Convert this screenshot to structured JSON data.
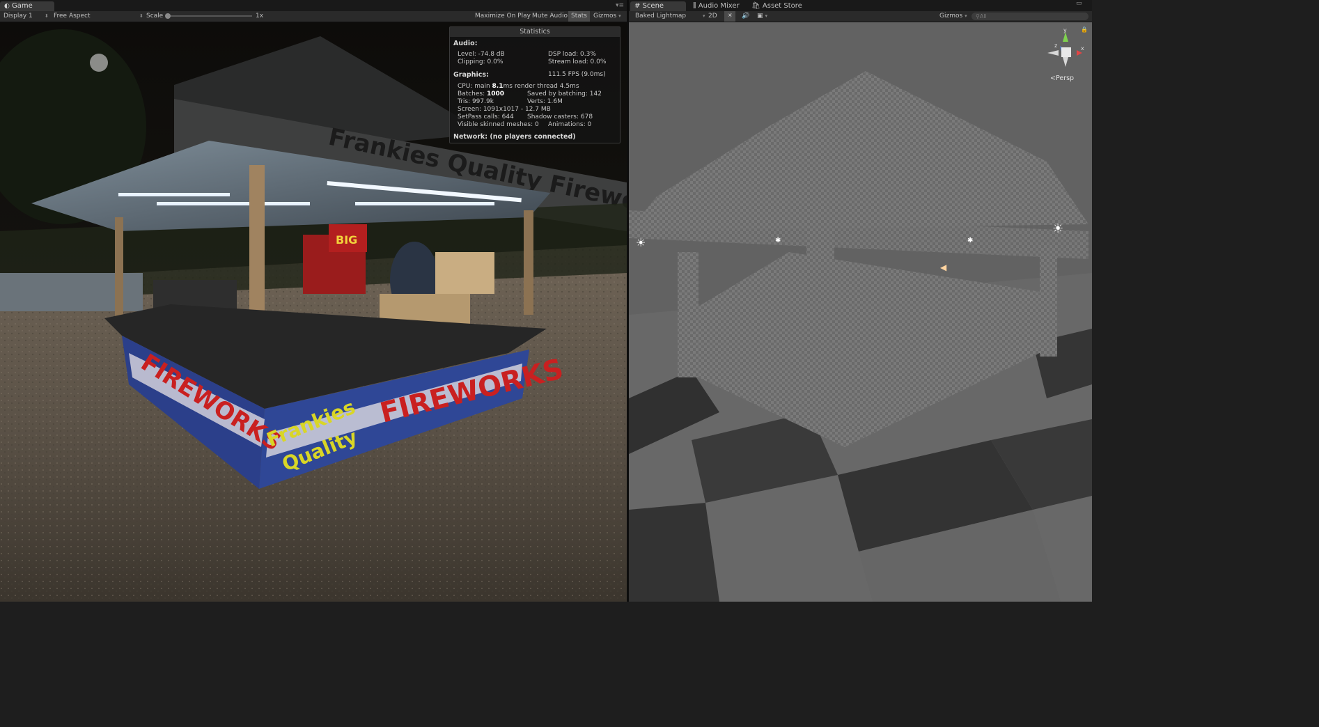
{
  "game_panel": {
    "tab_label": "Game",
    "display": "Display 1",
    "aspect": "Free Aspect",
    "scale_label": "Scale",
    "scale_value": "1x",
    "buttons": [
      "Maximize On Play",
      "Mute Audio",
      "Stats",
      "Gizmos"
    ],
    "active_button_index": 2
  },
  "scene_panel": {
    "tabs": [
      "Scene",
      "Audio Mixer",
      "Asset Store"
    ],
    "draw_mode": "Baked Lightmap",
    "mode_2d": "2D",
    "gizmos": "Gizmos",
    "search_placeholder": "All",
    "projection": "Persp",
    "gizmo_axes": {
      "y": "y",
      "x": "x",
      "z": "z"
    }
  },
  "stats": {
    "title": "Statistics",
    "audio_header": "Audio:",
    "level": "Level: -74.8 dB",
    "dsp_load": "DSP load: 0.3%",
    "clipping": "Clipping: 0.0%",
    "stream_load": "Stream load: 0.0%",
    "graphics_header": "Graphics:",
    "fps": "111.5 FPS (9.0ms)",
    "cpu_prefix": "CPU: main ",
    "cpu_main": "8.1",
    "cpu_suffix": "ms  render thread 4.5ms",
    "batches_prefix": "Batches: ",
    "batches": "1000",
    "saved_batching": "Saved by batching: 142",
    "tris": "Tris: 997.9k",
    "verts": "Verts: 1.6M",
    "screen": "Screen: 1091x1017 - 12.7 MB",
    "setpass": "SetPass calls: 644",
    "shadow_casters": "Shadow casters: 678",
    "skinned": "Visible skinned meshes: 0",
    "animations": "Animations: 0",
    "network": "Network: (no players connected)"
  },
  "scene_image": {
    "banner_top": "Frankies Quality Fireworks",
    "sign_fireworks": "FIREWORKS",
    "sign_frankies": "Frankies",
    "sign_quality": "Quality",
    "box_big": "BIG"
  }
}
